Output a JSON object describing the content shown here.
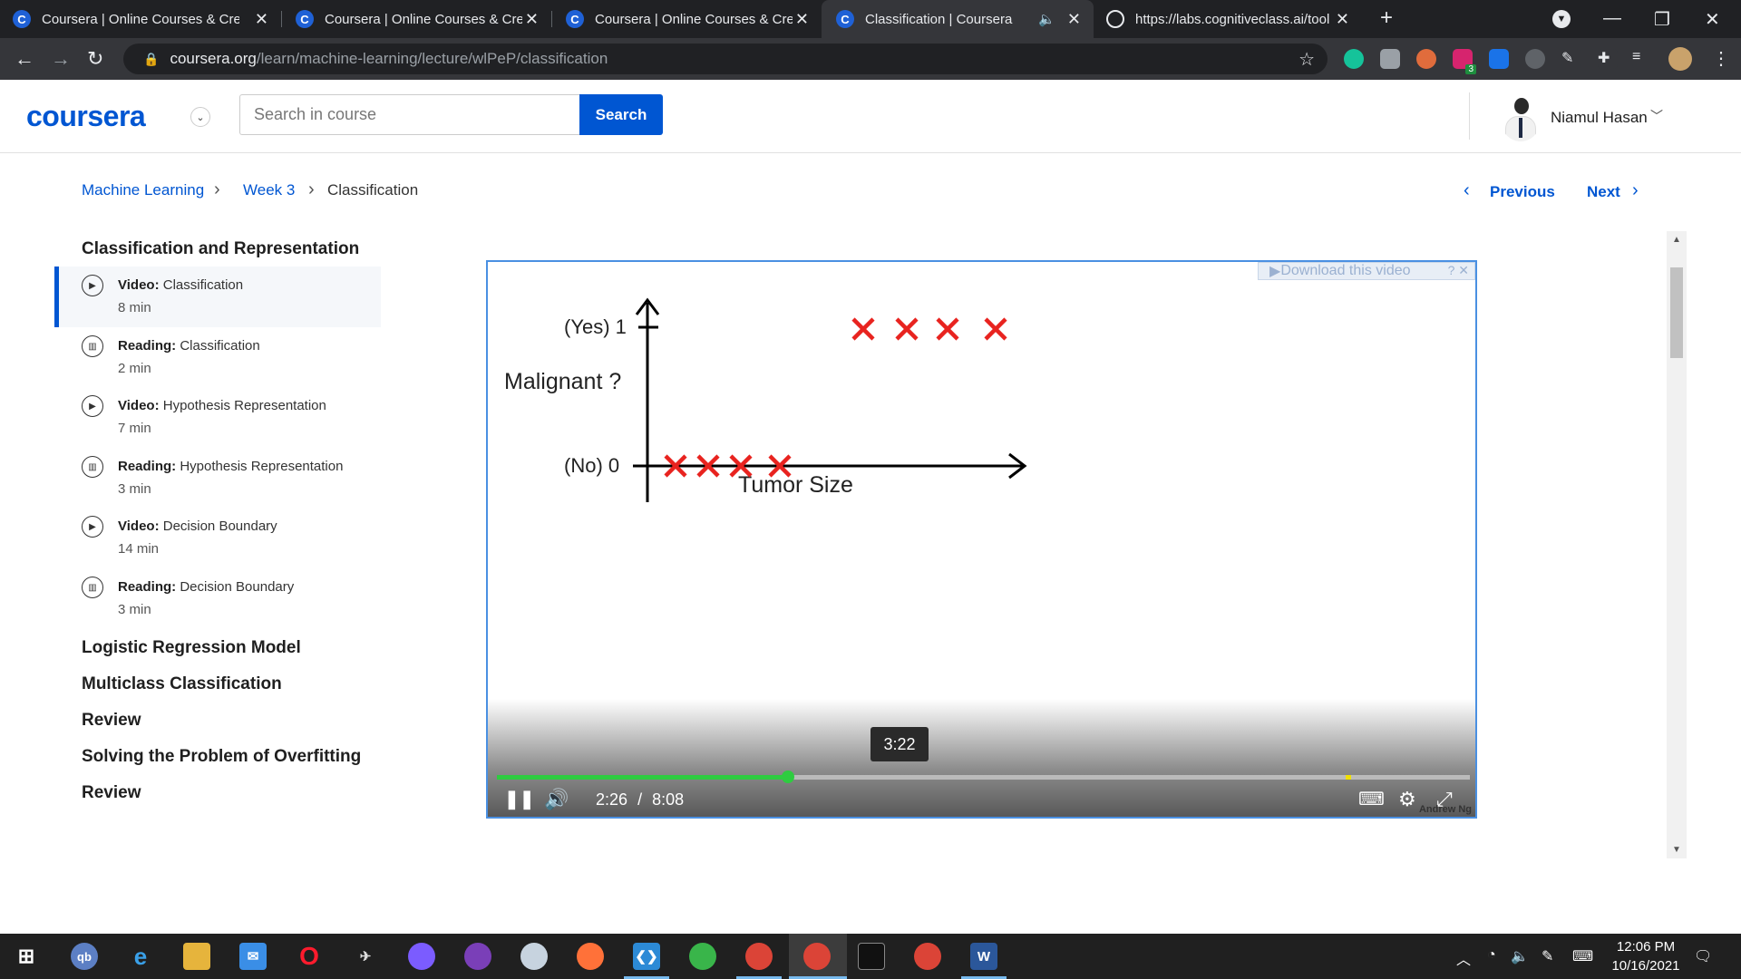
{
  "browser": {
    "tabs": [
      {
        "title": "Coursera | Online Courses & Cred",
        "favicon": "coursera-c"
      },
      {
        "title": "Coursera | Online Courses & Cred",
        "favicon": "coursera-c"
      },
      {
        "title": "Coursera | Online Courses & Cred",
        "favicon": "coursera-c"
      },
      {
        "title": "Classification | Coursera",
        "favicon": "coursera-c",
        "active": true
      },
      {
        "title": "https://labs.cognitiveclass.ai/tool",
        "favicon": "globe"
      }
    ],
    "url_host": "coursera.org",
    "url_path": "/learn/machine-learning/lecture/wlPeP/classification",
    "extension_badge": "3"
  },
  "header": {
    "logo": "coursera",
    "search_placeholder": "Search in course",
    "search_button": "Search",
    "user_name": "Niamul Hasan"
  },
  "breadcrumb": {
    "items": [
      "Machine Learning",
      "Week 3",
      "Classification"
    ],
    "previous": "Previous",
    "next": "Next"
  },
  "sidebar": {
    "current_section": "Classification and Representation",
    "items": [
      {
        "type": "Video:",
        "title": "Classification",
        "duration": "8 min",
        "icon": "play-circle-icon",
        "active": true
      },
      {
        "type": "Reading:",
        "title": "Classification",
        "duration": "2 min",
        "icon": "book-icon"
      },
      {
        "type": "Video:",
        "title": "Hypothesis Representation",
        "duration": "7 min",
        "icon": "play-circle-icon"
      },
      {
        "type": "Reading:",
        "title": "Hypothesis Representation",
        "duration": "3 min",
        "icon": "book-icon"
      },
      {
        "type": "Video:",
        "title": "Decision Boundary",
        "duration": "14 min",
        "icon": "play-circle-icon"
      },
      {
        "type": "Reading:",
        "title": "Decision Boundary",
        "duration": "3 min",
        "icon": "book-icon"
      }
    ],
    "sections": [
      "Logistic Regression Model",
      "Multiclass Classification",
      "Review",
      "Solving the Problem of Overfitting",
      "Review"
    ]
  },
  "video": {
    "download_label": "Download this video",
    "slide": {
      "y_top_label": "(Yes) 1",
      "y_bottom_label": "(No) 0",
      "y_axis_label": "Malignant ?",
      "x_axis_label": "Tumor Size"
    },
    "hover_time": "3:22",
    "current_time": "2:26",
    "time_sep": "/",
    "duration": "8:08",
    "progress_fraction": 0.299,
    "watermark": "Andrew Ng"
  },
  "taskbar": {
    "clock_time": "12:06 PM",
    "clock_date": "10/16/2021"
  }
}
